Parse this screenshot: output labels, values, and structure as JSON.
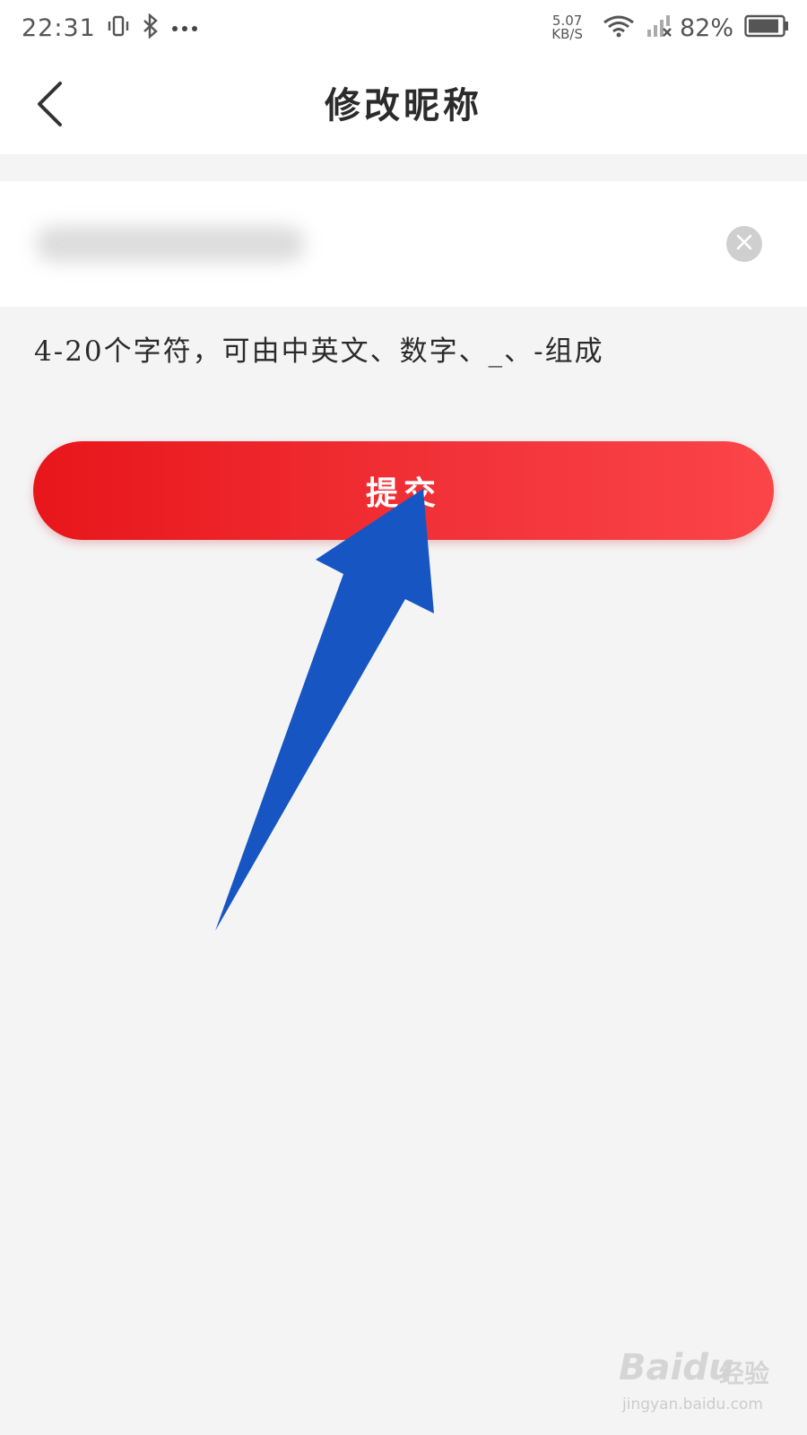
{
  "status_bar": {
    "time": "22:31",
    "net_speed_value": "5.07",
    "net_speed_unit": "KB/S",
    "battery_percent": "82%",
    "icons": [
      "vibrate-icon",
      "bluetooth-icon",
      "more-dots-icon",
      "wifi-icon",
      "signal-icon",
      "battery-icon"
    ]
  },
  "nav": {
    "title": "修改昵称",
    "back_icon": "chevron-left-icon"
  },
  "form": {
    "nickname_value": "",
    "clear_icon": "close-circle-icon",
    "hint": "4-20个字符，可由中英文、数字、_、-组成",
    "submit_label": "提交"
  },
  "annotation": {
    "arrow_color": "#1756c2"
  },
  "watermark": {
    "brand": "Baidu",
    "tag": "经验",
    "url": "jingyan.baidu.com"
  },
  "colors": {
    "accent_start": "#e8161a",
    "accent_end": "#fb4548",
    "background": "#f4f4f5"
  }
}
